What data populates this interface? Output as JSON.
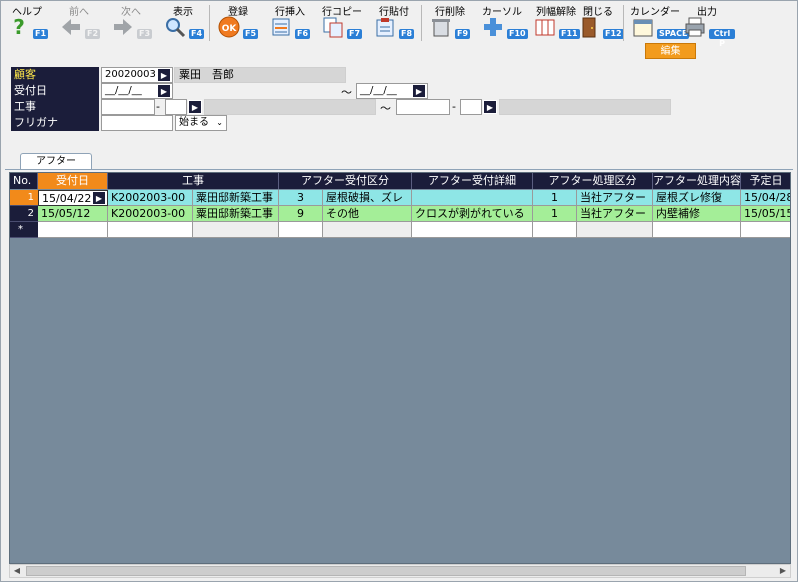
{
  "toolbar": {
    "help": {
      "label": "ヘルプ",
      "key": "F1"
    },
    "prev": {
      "label": "前へ",
      "key": "F2"
    },
    "next": {
      "label": "次へ",
      "key": "F3"
    },
    "view": {
      "label": "表示",
      "key": "F4"
    },
    "register": {
      "label": "登録",
      "key": "F5"
    },
    "row_insert": {
      "label": "行挿入",
      "key": "F6"
    },
    "row_copy": {
      "label": "行コピー",
      "key": "F7"
    },
    "row_paste": {
      "label": "行貼付",
      "key": "F8"
    },
    "row_delete": {
      "label": "行削除",
      "key": "F9"
    },
    "cursor": {
      "label": "カーソル",
      "key": "F10"
    },
    "col_width_reset": {
      "label": "列幅解除",
      "key": "F11"
    },
    "close": {
      "label": "閉じる",
      "key": "F12"
    },
    "calendar": {
      "label": "カレンダー",
      "key": "SPACE"
    },
    "output": {
      "label": "出力",
      "key": "Ctrl P"
    }
  },
  "edit_badge": "編集",
  "form": {
    "customer_label": "顧客",
    "customer_code": "20020003",
    "customer_name": "粟田　吾郎",
    "accept_date_label": "受付日",
    "date_placeholder": "__/__/__",
    "tilde": "～",
    "construction_label": "工事",
    "dash": "-",
    "furigana_label": "フリガナ",
    "furigana_mode": "始まる"
  },
  "tab_label": "アフター",
  "grid": {
    "columns": [
      "No.",
      "受付日",
      "工事",
      "アフター受付区分",
      "アフター受付詳細",
      "アフター処理区分",
      "アフター処理内容",
      "予定日"
    ],
    "rows": [
      {
        "no": "1",
        "date": "15/04/22",
        "code": "K2002003-00",
        "name": "粟田邸新築工事",
        "acc_no": "3",
        "acc_div": "屋根破損、ズレ",
        "acc_detail": "",
        "proc_no": "1",
        "proc_div": "当社アフター",
        "proc_content": "屋根ズレ修復",
        "plan": "15/04/28"
      },
      {
        "no": "2",
        "date": "15/05/12",
        "code": "K2002003-00",
        "name": "粟田邸新築工事",
        "acc_no": "9",
        "acc_div": "その他",
        "acc_detail": "クロスが剥がれている",
        "proc_no": "1",
        "proc_div": "当社アフター",
        "proc_content": "内壁補修",
        "plan": "15/05/15"
      }
    ],
    "new_row_marker": "*"
  },
  "colors": {
    "header_bg": "#1b1d3a",
    "accent_orange": "#f28a1a",
    "row1_bg": "#8ee6e6",
    "row2_bg": "#a4ee98",
    "empty_area": "#778a9b"
  }
}
